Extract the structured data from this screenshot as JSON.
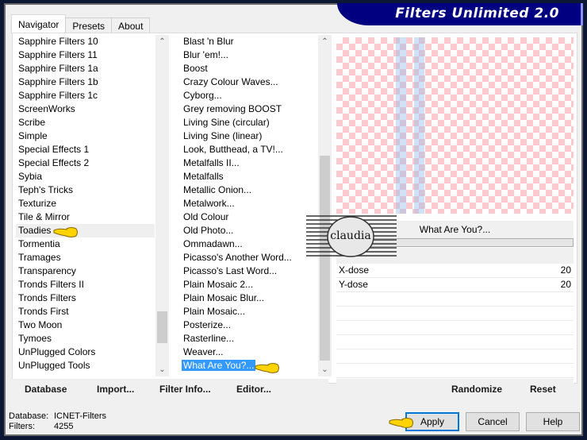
{
  "window": {
    "title": "Filters Unlimited 2.0",
    "colors": {
      "banner": "#000080",
      "selection": "#3399ff",
      "default_button_border": "#0078d7",
      "checker_pink": "#ffc8cc"
    }
  },
  "tabs": [
    {
      "label": "Navigator",
      "active": true
    },
    {
      "label": "Presets",
      "active": false
    },
    {
      "label": "About",
      "active": false
    }
  ],
  "categories": {
    "items": [
      "Sapphire Filters 10",
      "Sapphire Filters 11",
      "Sapphire Filters 1a",
      "Sapphire Filters 1b",
      "Sapphire Filters 1c",
      "ScreenWorks",
      "Scribe",
      "Simple",
      "Special Effects 1",
      "Special Effects 2",
      "Sybia",
      "Teph's Tricks",
      "Texturize",
      "Tile & Mirror",
      "Toadies",
      "Tormentia",
      "Tramages",
      "Transparency",
      "Tronds Filters II",
      "Tronds Filters",
      "Tronds First",
      "Two Moon",
      "Tymoes",
      "UnPlugged Colors",
      "UnPlugged Tools"
    ],
    "selected": "Toadies"
  },
  "filters": {
    "items": [
      "Blast 'n Blur",
      "Blur 'em!...",
      "Boost",
      "Crazy Colour Waves...",
      "Cyborg...",
      "Grey removing BOOST",
      "Living Sine (circular)",
      "Living Sine (linear)",
      "Look, Butthead, a TV!...",
      "Metalfalls II...",
      "Metalfalls",
      "Metallic Onion...",
      "Metalwork...",
      "Old Colour",
      "Old Photo...",
      "Ommadawn...",
      "Picasso's Another Word...",
      "Picasso's Last Word...",
      "Plain Mosaic 2...",
      "Plain Mosaic Blur...",
      "Plain Mosaic...",
      "Posterize...",
      "Rasterline...",
      "Weaver...",
      "What Are You?..."
    ],
    "selected": "What Are You?..."
  },
  "effect": {
    "name": "What Are You?...",
    "params": [
      {
        "label": "X-dose",
        "value": "20"
      },
      {
        "label": "Y-dose",
        "value": "20"
      }
    ]
  },
  "left_buttons": {
    "database": "Database",
    "import": "Import...",
    "filter_info": "Filter Info...",
    "editor": "Editor..."
  },
  "right_buttons": {
    "randomize": "Randomize",
    "reset": "Reset"
  },
  "status": {
    "database_label": "Database:",
    "database_value": "ICNET-Filters",
    "filters_label": "Filters:",
    "filters_value": "4255"
  },
  "dialog_buttons": {
    "apply": "Apply",
    "cancel": "Cancel",
    "help": "Help"
  },
  "watermark": {
    "text": "claudia"
  },
  "icons": {
    "scroll_up": "chevron-up-icon",
    "scroll_down": "chevron-down-icon",
    "pointer": "pointing-hand-icon"
  }
}
